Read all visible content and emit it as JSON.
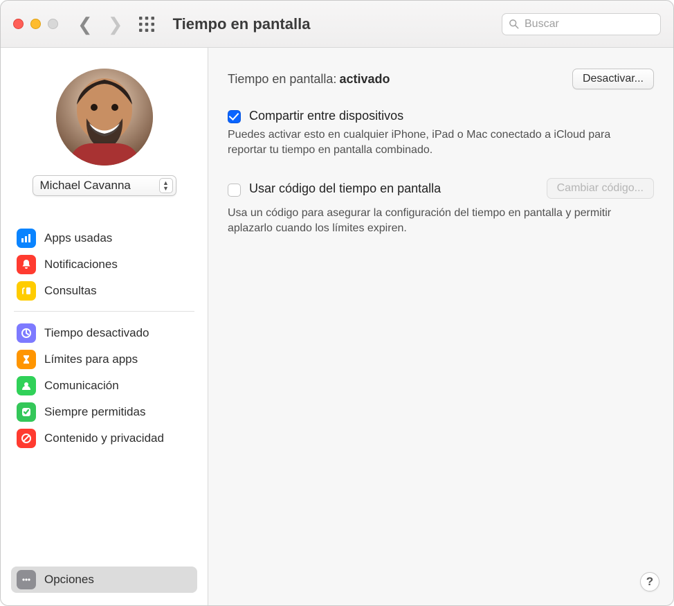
{
  "window": {
    "title": "Tiempo en pantalla",
    "search_placeholder": "Buscar"
  },
  "user": {
    "name": "Michael Cavanna"
  },
  "sidebar": {
    "groups": [
      {
        "items": [
          {
            "id": "apps",
            "label": "Apps usadas",
            "icon": "bar-chart-icon",
            "color": "#0a84ff"
          },
          {
            "id": "notif",
            "label": "Notificaciones",
            "icon": "bell-icon",
            "color": "#ff3b30"
          },
          {
            "id": "pickups",
            "label": "Consultas",
            "icon": "pickup-icon",
            "color": "#ffcc00"
          }
        ]
      },
      {
        "items": [
          {
            "id": "downtime",
            "label": "Tiempo desactivado",
            "icon": "clock-moon-icon",
            "color": "#7d7aff"
          },
          {
            "id": "limits",
            "label": "Límites para apps",
            "icon": "hourglass-icon",
            "color": "#ff9500"
          },
          {
            "id": "comm",
            "label": "Comunicación",
            "icon": "contact-icon",
            "color": "#30d158"
          },
          {
            "id": "allowed",
            "label": "Siempre permitidas",
            "icon": "check-shield-icon",
            "color": "#34c759"
          },
          {
            "id": "content",
            "label": "Contenido y privacidad",
            "icon": "no-entry-icon",
            "color": "#ff3b30"
          }
        ]
      }
    ],
    "footer": {
      "id": "options",
      "label": "Opciones",
      "icon": "dots-icon",
      "color": "#8e8e93",
      "selected": true
    }
  },
  "main": {
    "status_label": "Tiempo en pantalla:",
    "status_value": "activado",
    "turn_off_button": "Desactivar...",
    "share": {
      "checked": true,
      "title": "Compartir entre dispositivos",
      "desc": "Puedes activar esto en cualquier iPhone, iPad o Mac conectado a iCloud para reportar tu tiempo en pantalla combinado."
    },
    "passcode": {
      "checked": false,
      "title": "Usar código del tiempo en pantalla",
      "change_button": "Cambiar código...",
      "desc": "Usa un código para asegurar la configuración del tiempo en pantalla y permitir aplazarlo cuando los límites expiren."
    },
    "help": "?"
  }
}
